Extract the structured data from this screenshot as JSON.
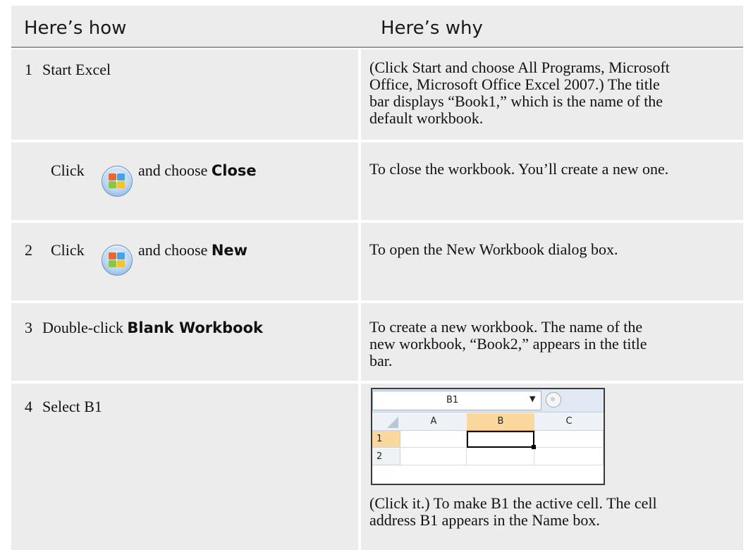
{
  "header": {
    "left": "Here’s how",
    "right": "Here’s why"
  },
  "rows": [
    {
      "num": "1",
      "how": "Start Excel",
      "why": [
        "(Click Start and choose All Programs, Microsoft",
        "Office, Microsoft Office Excel 2007.) The title",
        "bar displays “Book1,” which is the name of the",
        "default workbook."
      ]
    },
    {
      "num": "",
      "how_prefix": "Click",
      "how_suffix": "and choose",
      "how_bold": "Close",
      "icon": "office-button-icon",
      "why": [
        "To close the workbook. You’ll create a new one."
      ]
    },
    {
      "num": "2",
      "how_prefix": "Click",
      "how_suffix": "and choose",
      "how_bold": "New",
      "icon": "office-button-icon",
      "why": [
        "To open the New Workbook dialog box."
      ]
    },
    {
      "num": "3",
      "how_prefix": "Double-click",
      "how_bold": "Blank Workbook",
      "why": [
        "To create a new workbook. The name of the",
        "new workbook, “Book2,” appears in the title",
        "bar."
      ]
    },
    {
      "num": "4",
      "how": "Select B1",
      "screenshot": {
        "name_box": "B1",
        "columns": [
          "A",
          "B",
          "C"
        ],
        "rows": [
          "1",
          "2"
        ],
        "active_cell": "B1",
        "accent": "#f9d79d"
      },
      "why": [
        "(Click it.) To make B1 the active cell. The cell",
        "address B1 appears in the Name box."
      ]
    }
  ]
}
